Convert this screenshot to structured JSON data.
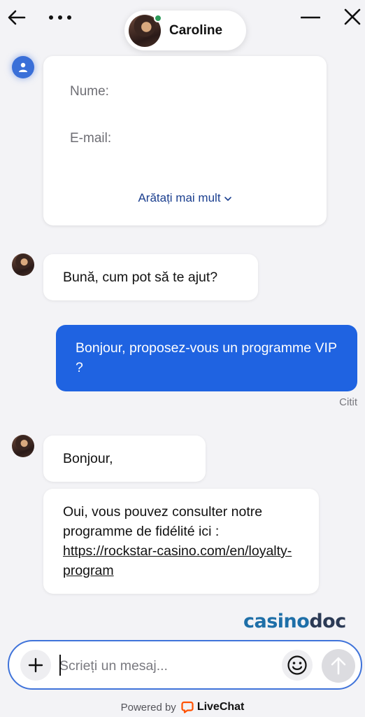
{
  "header": {
    "agent_name": "Caroline",
    "online_color": "#2d9b5a",
    "icons": [
      "arrow-left-icon",
      "more-dots-icon",
      "minimize-icon",
      "close-icon"
    ]
  },
  "form": {
    "name_label": "Nume:",
    "email_label": "E-mail:",
    "show_more": "Arătați mai mult"
  },
  "messages": [
    {
      "from": "agent",
      "text": "Bună, cum pot să te ajut?"
    },
    {
      "from": "visitor",
      "text": "Bonjour, proposez-vous un programme VIP ?",
      "status": "Citit"
    },
    {
      "from": "agent",
      "text": "Bonjour,"
    },
    {
      "from": "agent",
      "text_prefix": "Oui, vous pouvez consulter notre programme de fidélité ici : ",
      "link": "https://rockstar-casino.com/en/loyalty-program"
    }
  ],
  "watermark": {
    "part1": "casino",
    "part2": "doc"
  },
  "composer": {
    "placeholder": "Scrieți un mesaj..."
  },
  "footer": {
    "powered_by": "Powered by",
    "brand": "LiveChat",
    "brand_color": "#ff5100"
  },
  "colors": {
    "accent": "#1f63e1",
    "background": "#f3f3f6"
  }
}
